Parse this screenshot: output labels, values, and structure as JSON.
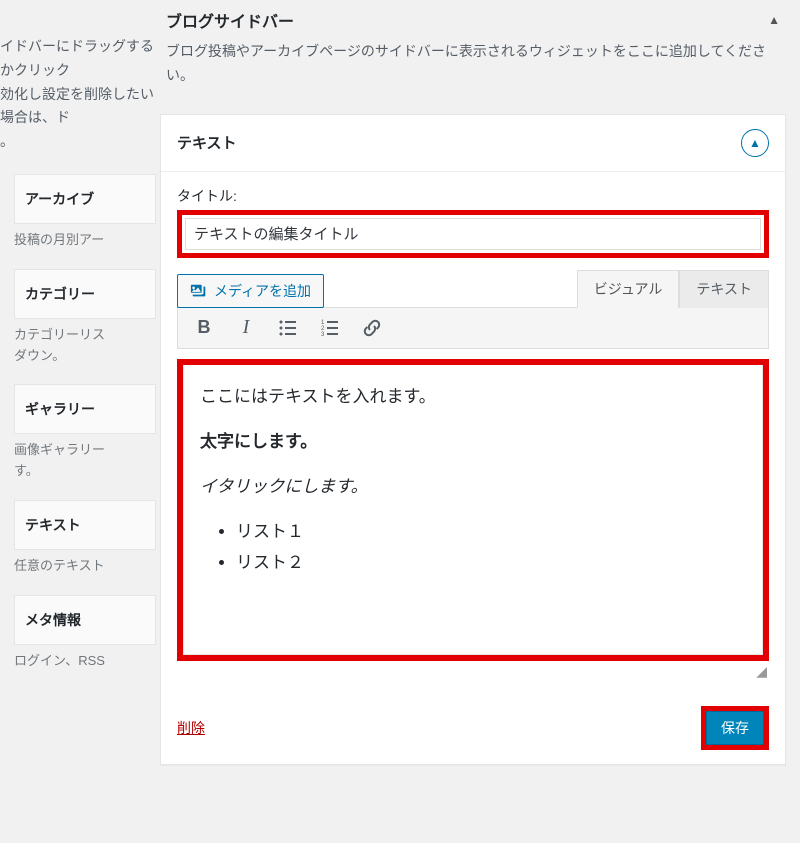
{
  "left": {
    "intro_line1": "イドバーにドラッグするかクリック",
    "intro_line2": "効化し設定を削除したい場合は、ド",
    "intro_line3": "。",
    "widgets": [
      {
        "title": "アーカイブ",
        "desc": "投稿の月別アー"
      },
      {
        "title": "カテゴリー",
        "desc": "カテゴリーリス\nダウン。"
      },
      {
        "title": "ギャラリー",
        "desc": "画像ギャラリー\nす。"
      },
      {
        "title": "テキスト",
        "desc": "任意のテキスト"
      },
      {
        "title": "メタ情報",
        "desc": "ログイン、RSS"
      }
    ]
  },
  "right": {
    "sidebar_title": "ブログサイドバー",
    "sidebar_desc": "ブログ投稿やアーカイブページのサイドバーに表示されるウィジェットをここに追加してください。"
  },
  "panel": {
    "head_title": "テキスト",
    "title_label": "タイトル:",
    "title_value": "テキストの編集タイトル",
    "media_btn": "メディアを追加",
    "tab_visual": "ビジュアル",
    "tab_text": "テキスト",
    "editor": {
      "line1": "ここにはテキストを入れます。",
      "line2": "太字にします。",
      "line3": "イタリックにします。",
      "list1": "リスト１",
      "list2": "リスト２"
    },
    "delete": "削除",
    "save": "保存"
  }
}
